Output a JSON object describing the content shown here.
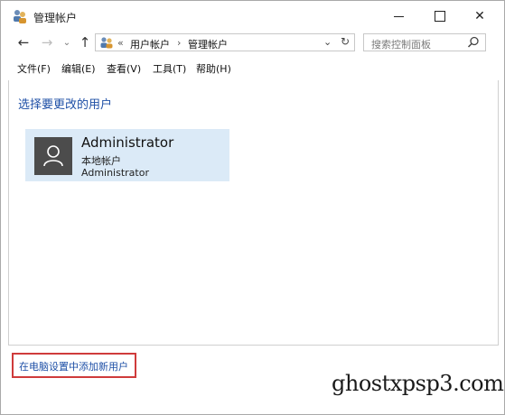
{
  "window": {
    "title": "管理帐户",
    "controls": {
      "minimize": "minimize",
      "maximize": "maximize",
      "close": "✕"
    }
  },
  "nav": {
    "back_icon": "←",
    "forward_icon": "→",
    "recent_icon": "⌄",
    "up_icon": "↑"
  },
  "address": {
    "sep": "«",
    "crumbs": [
      "用户帐户",
      "管理帐户"
    ],
    "crumb_sep": "›",
    "dropdown_icon": "⌄",
    "refresh_icon": "↻"
  },
  "search": {
    "placeholder": "搜索控制面板",
    "icon": "search-icon"
  },
  "menu": [
    "文件(F)",
    "编辑(E)",
    "查看(V)",
    "工具(T)",
    "帮助(H)"
  ],
  "main": {
    "heading": "选择要更改的用户",
    "accounts": [
      {
        "name": "Administrator",
        "type": "本地帐户",
        "full_name": "Administrator"
      }
    ]
  },
  "footer": {
    "add_user_link": "在电脑设置中添加新用户"
  },
  "watermark": "ghostxpsp3.com",
  "colors": {
    "link": "#1e4fa6",
    "card_bg": "#dbeaf7",
    "highlight_border": "#cf3b3b",
    "avatar_bg": "#4c4c4c"
  }
}
